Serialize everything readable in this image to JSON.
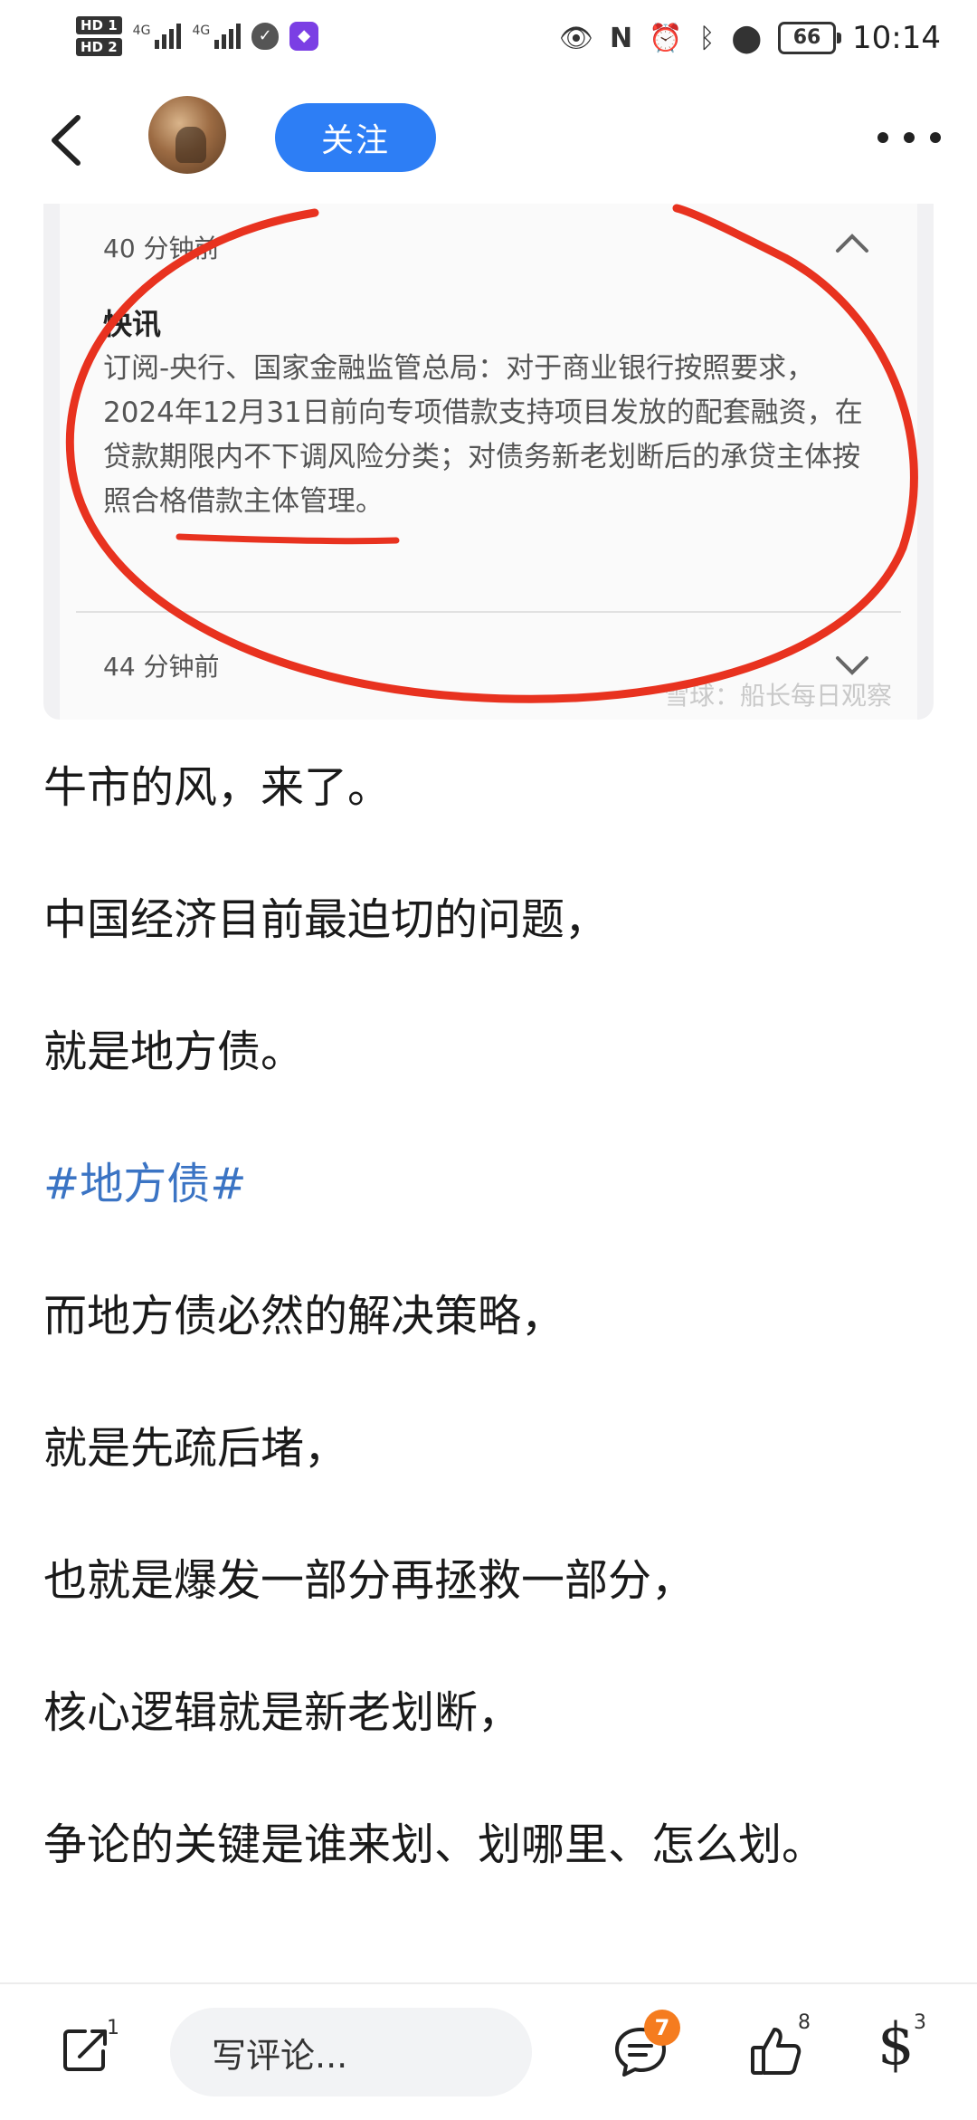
{
  "status_bar": {
    "sim1": "HD 1",
    "sim2": "HD 2",
    "net1": "4G",
    "net2": "4G",
    "battery": "66",
    "time": "10:14"
  },
  "header": {
    "follow_label": "关注"
  },
  "embedded_screenshot": {
    "time_top": "40 分钟前",
    "title": "快讯",
    "body": "订阅-央行、国家金融监管总局：对于商业银行按照要求，2024年12月31日前向专项借款支持项目发放的配套融资，在贷款期限内不下调风险分类；对债务新老划断后的承贷主体按照合格借款主体管理。",
    "time_bottom": "44 分钟前",
    "watermark": "雪球：船长每日观察",
    "annotation_color": "#e8321f"
  },
  "article": {
    "paragraphs": [
      "牛市的风，来了。",
      "中国经济目前最迫切的问题，",
      "就是地方债。",
      "#地方债#",
      "而地方债必然的解决策略，",
      "就是先疏后堵，",
      "也就是爆发一部分再拯救一部分，",
      "核心逻辑就是新老划断，",
      "争论的关键是谁来划、划哪里、怎么划。"
    ],
    "tag_color": "#3b74c4"
  },
  "bottom_bar": {
    "share_count": "1",
    "comment_placeholder": "写评论...",
    "comment_count": "7",
    "like_count": "8",
    "reward_count": "3",
    "badge_color": "#f57c1f"
  }
}
